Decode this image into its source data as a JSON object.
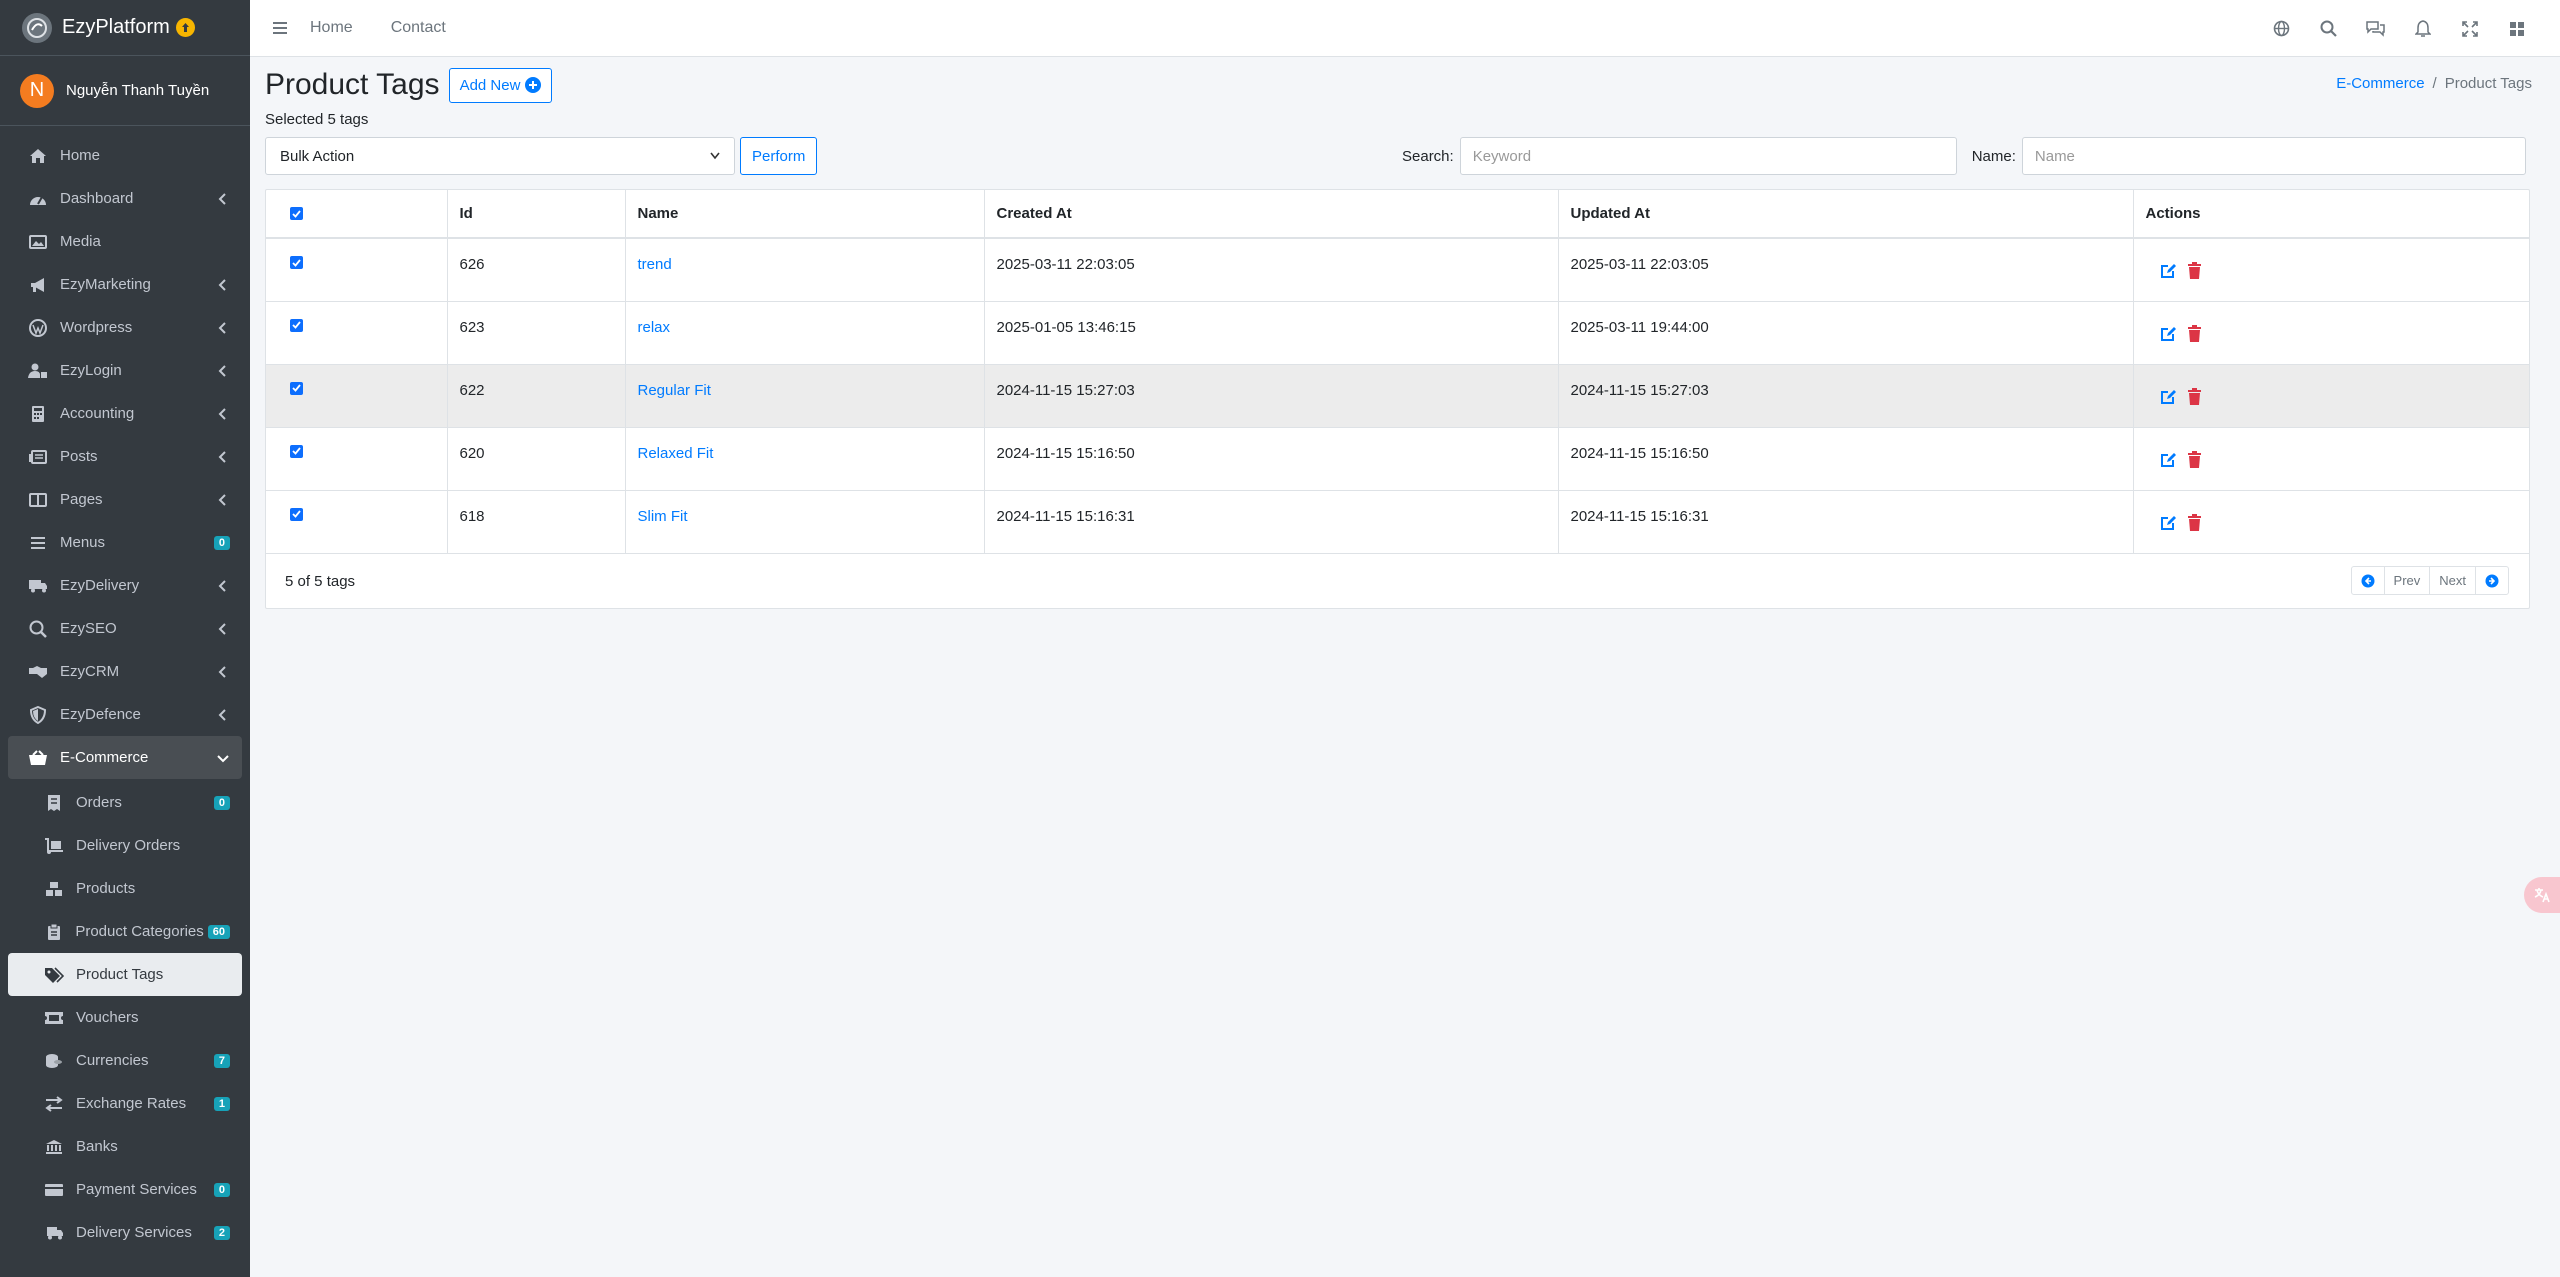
{
  "brand": {
    "name": "EzyPlatform"
  },
  "user": {
    "initial": "N",
    "name": "Nguyễn Thanh Tuyền"
  },
  "sidebar": {
    "items": [
      {
        "label": "Home"
      },
      {
        "label": "Dashboard"
      },
      {
        "label": "Media"
      },
      {
        "label": "EzyMarketing"
      },
      {
        "label": "Wordpress"
      },
      {
        "label": "EzyLogin"
      },
      {
        "label": "Accounting"
      },
      {
        "label": "Posts"
      },
      {
        "label": "Pages"
      },
      {
        "label": "Menus",
        "badge": "0"
      },
      {
        "label": "EzyDelivery"
      },
      {
        "label": "EzySEO"
      },
      {
        "label": "EzyCRM"
      },
      {
        "label": "EzyDefence"
      },
      {
        "label": "E-Commerce"
      }
    ],
    "sub_items": [
      {
        "label": "Orders",
        "badge": "0"
      },
      {
        "label": "Delivery Orders"
      },
      {
        "label": "Products"
      },
      {
        "label": "Product Categories",
        "badge": "60"
      },
      {
        "label": "Product Tags"
      },
      {
        "label": "Vouchers"
      },
      {
        "label": "Currencies",
        "badge": "7"
      },
      {
        "label": "Exchange Rates",
        "badge": "1"
      },
      {
        "label": "Banks"
      },
      {
        "label": "Payment Services",
        "badge": "0"
      },
      {
        "label": "Delivery Services",
        "badge": "2"
      }
    ]
  },
  "topbar": {
    "links": [
      "Home",
      "Contact"
    ]
  },
  "header": {
    "title": "Product Tags",
    "add_label": "Add New"
  },
  "breadcrumb": {
    "parent": "E-Commerce",
    "current": "Product Tags"
  },
  "selection": {
    "text": "Selected 5 tags"
  },
  "toolbar": {
    "bulk_value": "Bulk Action",
    "perform_label": "Perform",
    "search_label": "Search:",
    "search_placeholder": "Keyword",
    "name_label": "Name:",
    "name_placeholder": "Name"
  },
  "table": {
    "columns": [
      "Id",
      "Name",
      "Created At",
      "Updated At",
      "Actions"
    ],
    "rows": [
      {
        "id": "626",
        "name": "trend",
        "created": "2025-03-11 22:03:05",
        "updated": "2025-03-11 22:03:05"
      },
      {
        "id": "623",
        "name": "relax",
        "created": "2025-01-05 13:46:15",
        "updated": "2025-03-11 19:44:00"
      },
      {
        "id": "622",
        "name": "Regular Fit",
        "created": "2024-11-15 15:27:03",
        "updated": "2024-11-15 15:27:03"
      },
      {
        "id": "620",
        "name": "Relaxed Fit",
        "created": "2024-11-15 15:16:50",
        "updated": "2024-11-15 15:16:50"
      },
      {
        "id": "618",
        "name": "Slim Fit",
        "created": "2024-11-15 15:16:31",
        "updated": "2024-11-15 15:16:31"
      }
    ]
  },
  "footer": {
    "count_text": "5 of 5 tags",
    "prev": "Prev",
    "next": "Next"
  },
  "colors": {
    "accent": "#007bff",
    "sidebar_bg": "#343a40",
    "badge": "#17a2b8",
    "danger": "#dc3545"
  }
}
